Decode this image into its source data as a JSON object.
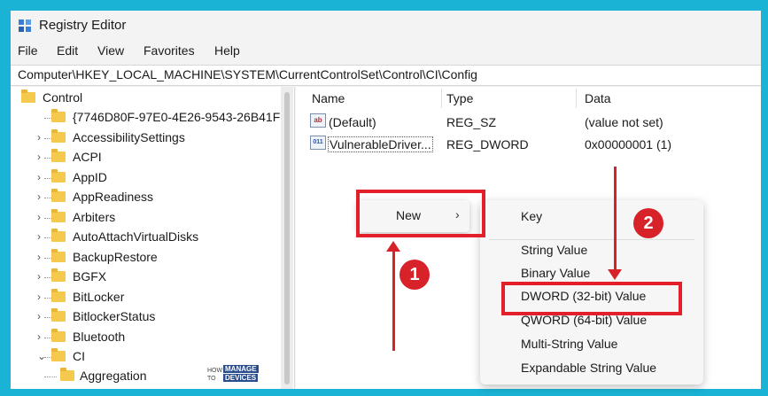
{
  "window": {
    "title": "Registry Editor"
  },
  "menu": [
    "File",
    "Edit",
    "View",
    "Favorites",
    "Help"
  ],
  "address": "Computer\\HKEY_LOCAL_MACHINE\\SYSTEM\\CurrentControlSet\\Control\\CI\\Config",
  "tree": {
    "root": "Control",
    "items": [
      "{7746D80F-97E0-4E26-9543-26B41F",
      "AccessibilitySettings",
      "ACPI",
      "AppID",
      "AppReadiness",
      "Arbiters",
      "AutoAttachVirtualDisks",
      "BackupRestore",
      "BGFX",
      "BitLocker",
      "BitlockerStatus",
      "Bluetooth",
      "CI"
    ],
    "child": "Aggregation"
  },
  "list": {
    "headers": [
      "Name",
      "Type",
      "Data"
    ],
    "rows": [
      {
        "icon": "string-value-icon",
        "glyph": "ab",
        "name": "(Default)",
        "type": "REG_SZ",
        "data": "(value not set)"
      },
      {
        "icon": "binary-value-icon",
        "glyph": "011",
        "name": "VulnerableDriver...",
        "type": "REG_DWORD",
        "data": "0x00000001 (1)"
      }
    ]
  },
  "context_menu": {
    "new_label": "New",
    "arrow": "›"
  },
  "submenu": {
    "items": [
      "Key",
      "String Value",
      "Binary Value",
      "DWORD (32-bit) Value",
      "QWORD (64-bit) Value",
      "Multi-String Value",
      "Expandable String Value"
    ]
  },
  "annotations": {
    "badge1": "1",
    "badge2": "2"
  },
  "watermark": {
    "how": "HOW TO",
    "brand1": "MANAGE",
    "brand2": "DEVICES"
  },
  "colors": {
    "accent": "#d8222a",
    "frame": "#1ab3d6",
    "folder": "#f4c94d"
  }
}
